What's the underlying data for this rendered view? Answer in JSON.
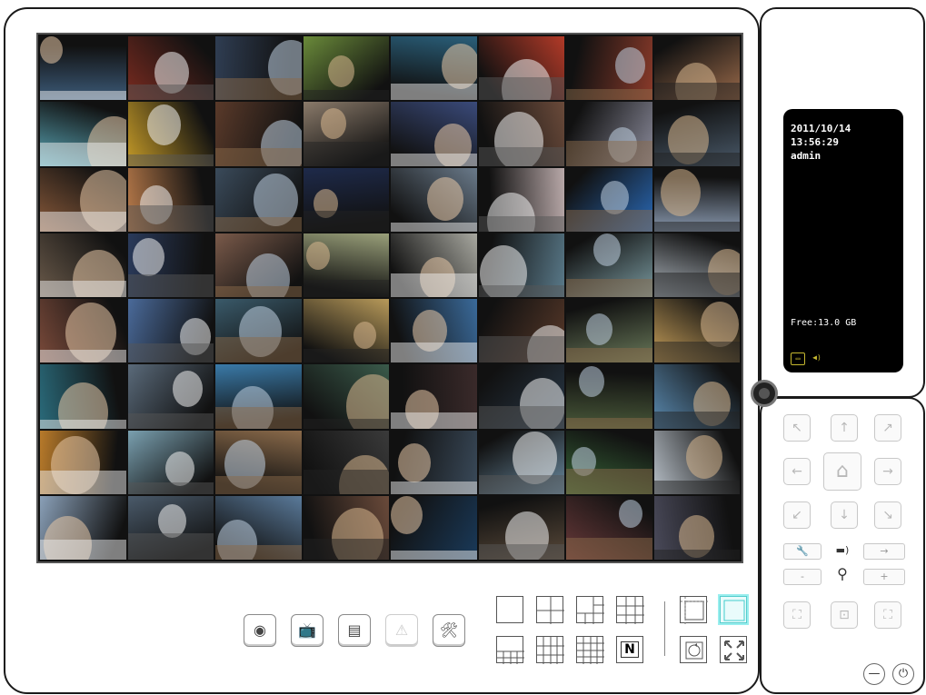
{
  "info": {
    "date": "2011/10/14",
    "time": "13:56:29",
    "user": "admin",
    "free_space": "Free:13.0 GB"
  },
  "camera_grid": {
    "rows": 8,
    "cols": 8,
    "tile_colors": [
      "#3c5a78",
      "#7a2b20",
      "#2f3d52",
      "#6a8a3a",
      "#2a5f7a",
      "#b23a28",
      "#8a3a2a",
      "#9a6a4a",
      "#5aa8b8",
      "#c49a28",
      "#5a3a2a",
      "#8a7a6a",
      "#3a4a7a",
      "#6a4a3a",
      "#8a8a9a",
      "#4a5a6a",
      "#8a5a3a",
      "#b87a4a",
      "#3a4a5a",
      "#1e2a4a",
      "#6a7a8a",
      "#b8a8a8",
      "#2a6ab8",
      "#8a9ab0",
      "#6a5a4a",
      "#2a3a5a",
      "#7a5a4a",
      "#9aa07a",
      "#a8a8a0",
      "#5a7a8a",
      "#7a9aa0",
      "#b0b8c0",
      "#7a4a3a",
      "#4a6a9a",
      "#3a5a6a",
      "#b89a5a",
      "#3a6a9a",
      "#5a3a2a",
      "#6a7a5a",
      "#c8a05a",
      "#2a6a7a",
      "#5a6a7a",
      "#3a7aa8",
      "#3a5a4a",
      "#3a2a2a",
      "#2a3a4a",
      "#4a5a3a",
      "#5a8ab0",
      "#b87a2a",
      "#7aa0b0",
      "#8a6a4a",
      "#3a3a3a",
      "#3a4a5a",
      "#6a8aa0",
      "#3a6a3a",
      "#b8c0c8",
      "#8aa0b8",
      "#4a5a6a",
      "#5a7a9a",
      "#6a4a3a",
      "#1a3a5a",
      "#5a4a3a",
      "#6a3a3a",
      "#4a4a5a"
    ]
  },
  "toolbar": {
    "record_icon": "record-icon",
    "tv_icon": "tv-playback-icon",
    "card_icon": "card-icon",
    "alert_icon": "alert-warning-icon",
    "tools_icon": "tools-settings-icon",
    "record_glyph": "◉",
    "tv_glyph": "📺",
    "card_glyph": "▤",
    "alert_glyph": "⚠",
    "tools_glyph": "🛠"
  },
  "layout": {
    "channel_letter": "N"
  },
  "ptz": {
    "up": "↑",
    "down": "↓",
    "left": "←",
    "right": "→",
    "up_left": "↖",
    "up_right": "↗",
    "down_left": "↙",
    "down_right": "↘",
    "home": "⌂",
    "zoom_minus": "-",
    "zoom_plus": "+",
    "tool": "🔧",
    "speed": "▬)",
    "step": "→",
    "search": "⚲"
  },
  "system": {
    "minimize": "—",
    "power": "⏻"
  }
}
